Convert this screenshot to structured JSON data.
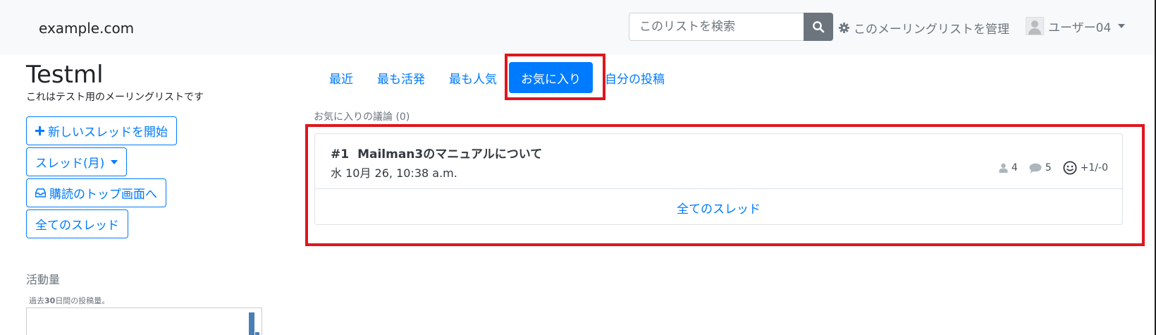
{
  "header": {
    "brand": "example.com",
    "search_placeholder": "このリストを検索",
    "manage_label": "このメーリングリストを管理",
    "user_label": "ユーザー04"
  },
  "list": {
    "title": "Testml",
    "description": "これはテスト用のメーリングリストです"
  },
  "sidebar": {
    "new_thread_label": "新しいスレッドを開始",
    "threads_month_label": "スレッド(月)",
    "subscribe_top_label": "購読のトップ画面へ",
    "all_threads_label": "全てのスレッド",
    "activity_label": "活動量",
    "graph_caption_prefix": "過去",
    "graph_caption_days": "30",
    "graph_caption_suffix": "日間の投稿量。"
  },
  "tabs": {
    "recent": "最近",
    "most_active": "最も活発",
    "most_popular": "最も人気",
    "favorites": "お気に入り",
    "my_posts": "自分の投稿"
  },
  "favorites": {
    "label": "お気に入りの議論",
    "count": "(0)",
    "thread": {
      "number": "#1",
      "title": "Mailman3のマニュアルについて",
      "date": "水 10月 26, 10:38 a.m.",
      "participants": "4",
      "replies": "5",
      "votes": "+1/-0"
    },
    "all_threads_link": "全てのスレッド"
  },
  "colors": {
    "primary": "#007bff",
    "highlight": "#e0161e",
    "muted": "#6c757d"
  }
}
